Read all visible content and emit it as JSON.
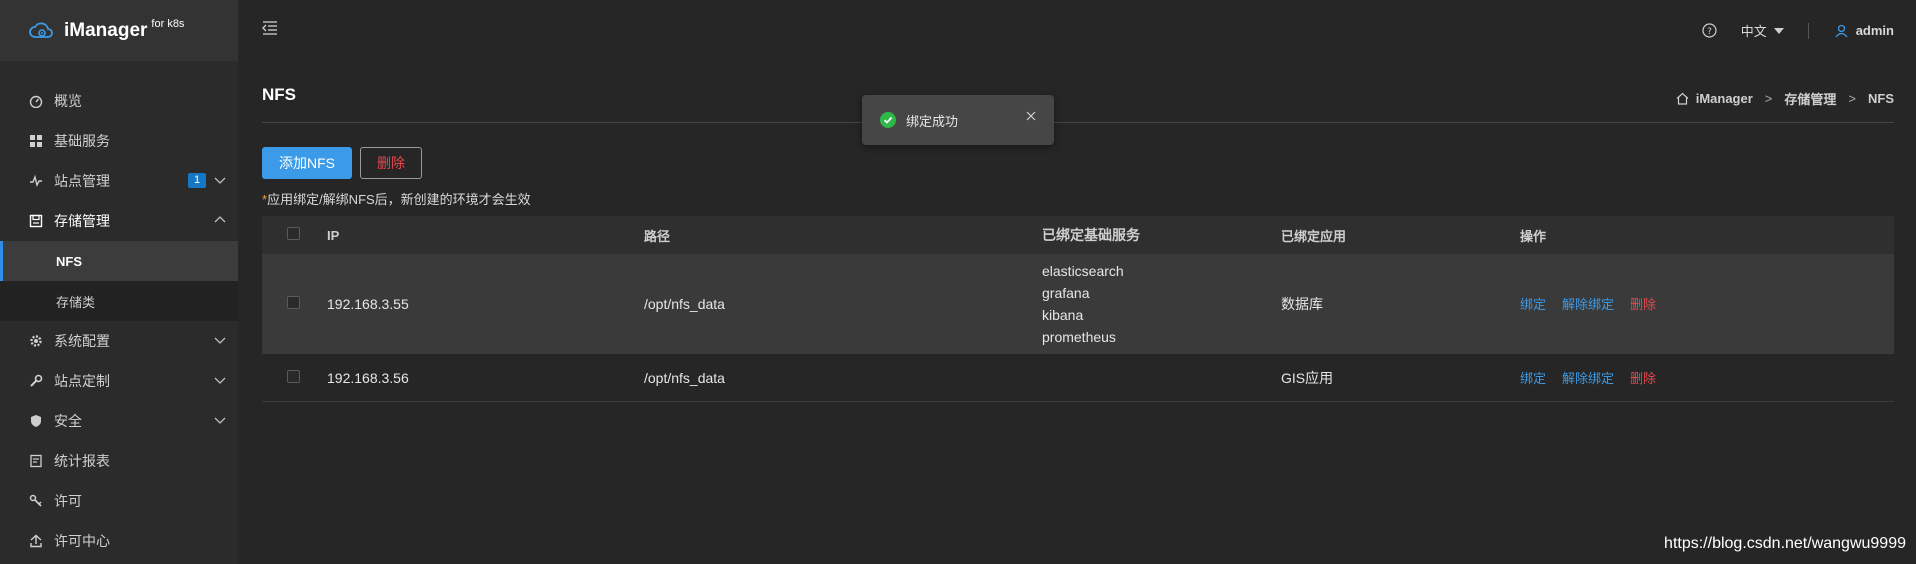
{
  "app": {
    "title": "iManager",
    "title_sup": "for k8s"
  },
  "topbar": {
    "language": "中文",
    "user": "admin"
  },
  "sidebar": {
    "items": [
      {
        "label": "概览",
        "icon": "dashboard-icon"
      },
      {
        "label": "基础服务",
        "icon": "grid-icon"
      },
      {
        "label": "站点管理",
        "icon": "pulse-icon",
        "badge": "1"
      },
      {
        "label": "存储管理",
        "icon": "storage-icon"
      },
      {
        "label": "系统配置",
        "icon": "gear-icon"
      },
      {
        "label": "站点定制",
        "icon": "wrench-icon"
      },
      {
        "label": "安全",
        "icon": "shield-icon"
      },
      {
        "label": "统计报表",
        "icon": "report-icon"
      },
      {
        "label": "许可",
        "icon": "key-icon"
      },
      {
        "label": "许可中心",
        "icon": "upload-icon"
      }
    ],
    "storage_sub": [
      {
        "label": "NFS",
        "active": true
      },
      {
        "label": "存储类",
        "active": false
      }
    ]
  },
  "page": {
    "title": "NFS",
    "breadcrumb": [
      "iManager",
      "存储管理",
      "NFS"
    ],
    "add_button": "添加NFS",
    "delete_button": "删除",
    "note_star": "*",
    "note": "应用绑定/解绑NFS后，新创建的环境才会生效"
  },
  "table": {
    "headers": {
      "ip": "IP",
      "path": "路径",
      "services": "已绑定基础服务",
      "apps": "已绑定应用",
      "ops": "操作"
    },
    "rows": [
      {
        "ip": "192.168.3.55",
        "path": "/opt/nfs_data",
        "services": [
          "elasticsearch",
          "grafana",
          "kibana",
          "prometheus"
        ],
        "apps": "数据库"
      },
      {
        "ip": "192.168.3.56",
        "path": "/opt/nfs_data",
        "services": [],
        "apps": "GIS应用"
      }
    ],
    "ops": {
      "bind": "绑定",
      "unbind": "解除绑定",
      "delete": "删除"
    }
  },
  "toast": {
    "message": "绑定成功"
  },
  "watermark": "https://blog.csdn.net/wangwu9999",
  "colors": {
    "accent": "#3b9be8",
    "danger": "#e5484d",
    "success": "#2fb84a",
    "badge": "#1677c7"
  }
}
